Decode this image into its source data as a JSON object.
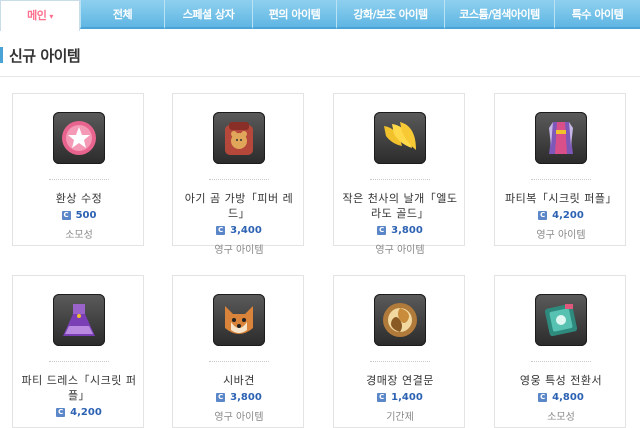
{
  "tabs": [
    {
      "label": "메인",
      "active": true
    },
    {
      "label": "전체"
    },
    {
      "label": "스페셜 상자"
    },
    {
      "label": "편의 아이템"
    },
    {
      "label": "강화/보조 아이템"
    },
    {
      "label": "코스튬/염색아이템"
    },
    {
      "label": "특수 아이템"
    }
  ],
  "section": {
    "title": "신규 아이템"
  },
  "items": [
    {
      "name_lines": [
        "환상 수정"
      ],
      "price": "500",
      "type": "소모성",
      "icon": "pink-star-orb-icon"
    },
    {
      "name_lines": [
        "아기 곰 가방「피버 레",
        "드」"
      ],
      "price": "3,400",
      "type": "영구 아이템",
      "icon": "bear-backpack-icon"
    },
    {
      "name_lines": [
        "작은 천사의 날개「엘도",
        "라도 골드」"
      ],
      "price": "3,800",
      "type": "영구 아이템",
      "icon": "golden-wings-icon"
    },
    {
      "name_lines": [
        "파티복「시크릿 퍼플」"
      ],
      "price": "4,200",
      "type": "영구 아이템",
      "icon": "purple-party-outfit-icon"
    },
    {
      "name_lines": [
        "파티 드레스「시크릿 퍼",
        "플」"
      ],
      "price": "4,200",
      "type": "",
      "icon": "purple-dress-icon"
    },
    {
      "name_lines": [
        "시바견"
      ],
      "price": "3,800",
      "type": "영구 아이템",
      "icon": "shiba-dog-icon"
    },
    {
      "name_lines": [
        "경매장 연결문"
      ],
      "price": "1,400",
      "type": "기간제",
      "icon": "auction-portal-icon"
    },
    {
      "name_lines": [
        "영웅 특성 전환서"
      ],
      "price": "4,800",
      "type": "소모성",
      "icon": "trait-scroll-icon"
    }
  ],
  "colors": {
    "tab": "#6cbde6",
    "active_tab_text": "#ff6f8d",
    "price": "#2d62b3"
  }
}
